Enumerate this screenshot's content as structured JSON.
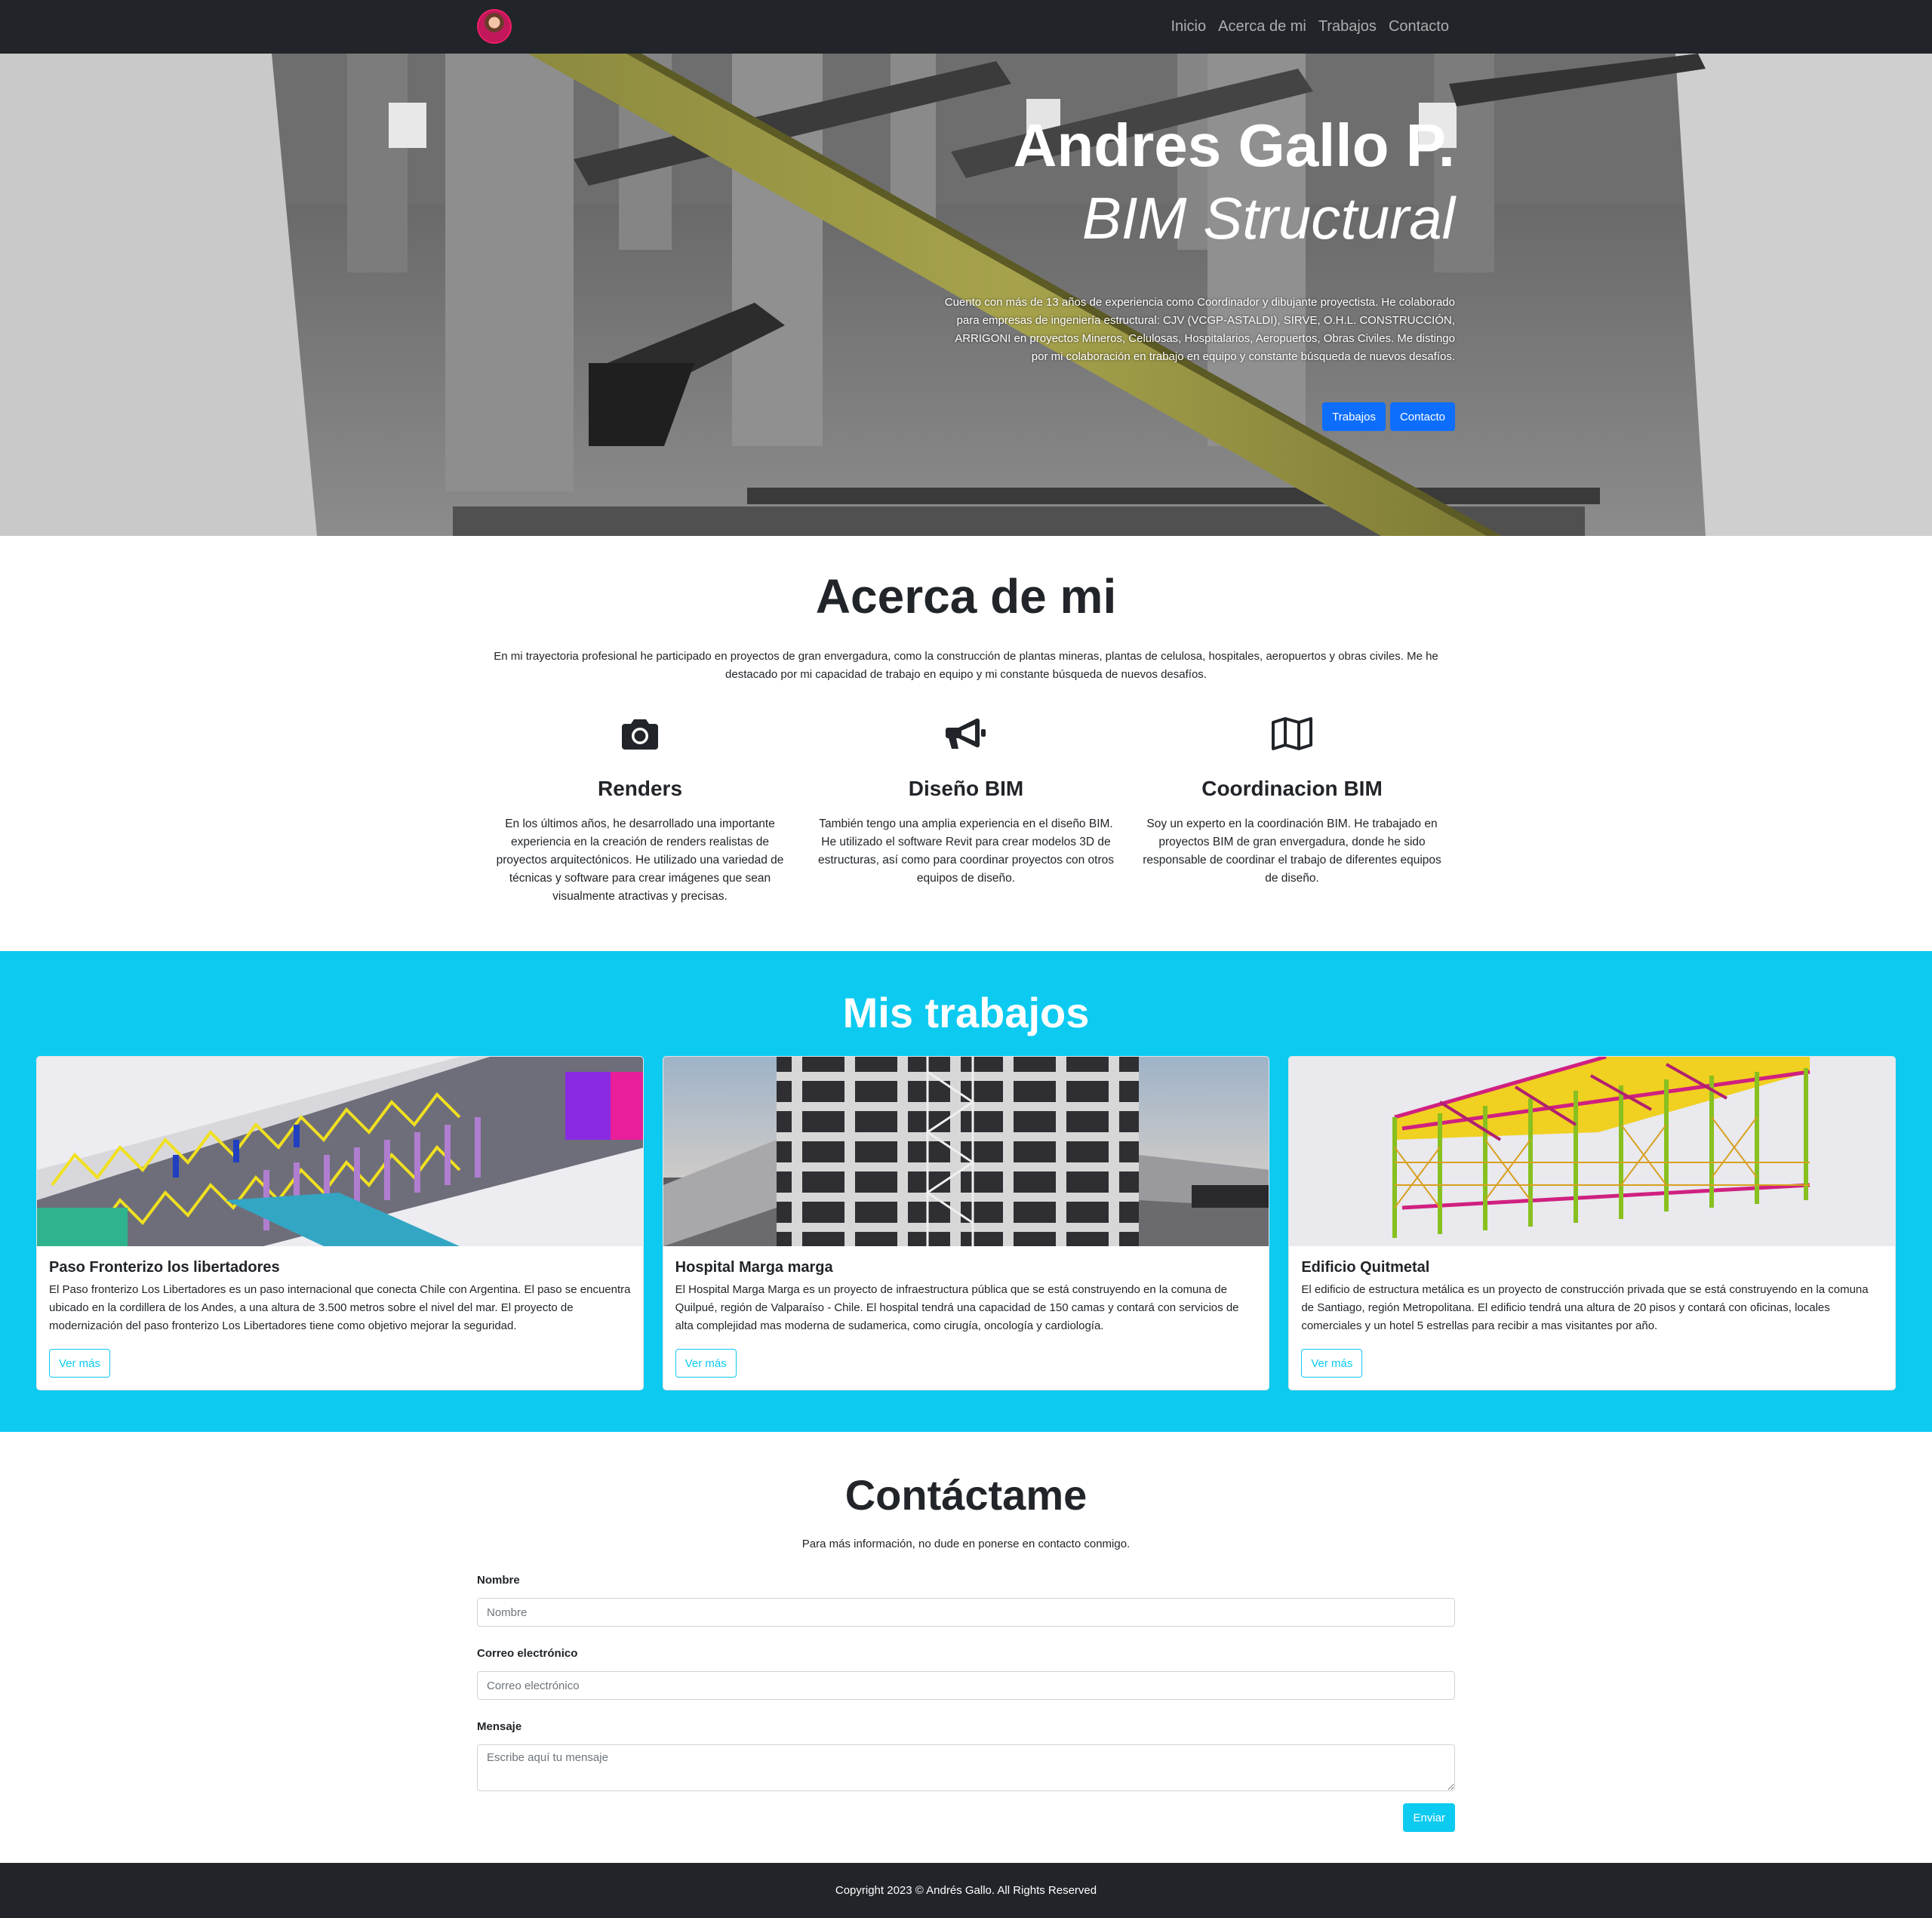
{
  "nav": {
    "links": [
      "Inicio",
      "Acerca de mi",
      "Trabajos",
      "Contacto"
    ]
  },
  "hero": {
    "name": "Andres Gallo P.",
    "role": "BIM Structural",
    "description": "Cuento con más de 13 años de experiencia como Coordinador y dibujante proyectista. He colaborado para empresas de ingeniería estructural: CJV (VCGP-ASTALDI), SIRVE, O.H.L. CONSTRUCCIÓN, ARRIGONI en proyectos Mineros, Celulosas, Hospitalarios, Aeropuertos, Obras Civiles. Me distingo por mi colaboración en trabajo en equipo y constante búsqueda de nuevos desafíos.",
    "btn_works": "Trabajos",
    "btn_contact": "Contacto"
  },
  "about": {
    "title": "Acerca de mi",
    "intro": "En mi trayectoria profesional he participado en proyectos de gran envergadura, como la construcción de plantas mineras, plantas de celulosa, hospitales, aeropuertos y obras civiles. Me he destacado por mi capacidad de trabajo en equipo y mi constante búsqueda de nuevos desafíos.",
    "features": [
      {
        "icon": "camera-icon",
        "title": "Renders",
        "text": "En los últimos años, he desarrollado una importante experiencia en la creación de renders realistas de proyectos arquitectónicos. He utilizado una variedad de técnicas y software para crear imágenes que sean visualmente atractivas y precisas."
      },
      {
        "icon": "megaphone-icon",
        "title": "Diseño BIM",
        "text": "También tengo una amplia experiencia en el diseño BIM. He utilizado el software Revit para crear modelos 3D de estructuras, así como para coordinar proyectos con otros equipos de diseño."
      },
      {
        "icon": "map-icon",
        "title": "Coordinacion BIM",
        "text": "Soy un experto en la coordinación BIM. He trabajado en proyectos BIM de gran envergadura, donde he sido responsable de coordinar el trabajo de diferentes equipos de diseño."
      }
    ]
  },
  "works": {
    "title": "Mis trabajos",
    "cards": [
      {
        "title": "Paso Fronterizo los libertadores",
        "text": "El Paso fronterizo Los Libertadores es un paso internacional que conecta Chile con Argentina. El paso se encuentra ubicado en la cordillera de los Andes, a una altura de 3.500 metros sobre el nivel del mar. El proyecto de modernización del paso fronterizo Los Libertadores tiene como objetivo mejorar la seguridad.",
        "button": "Ver más"
      },
      {
        "title": "Hospital Marga marga",
        "text": "El Hospital Marga Marga es un proyecto de infraestructura pública que se está construyendo en la comuna de Quilpué, región de Valparaíso - Chile. El hospital tendrá una capacidad de 150 camas y contará con servicios de alta complejidad mas moderna de sudamerica, como cirugía, oncología y cardiología.",
        "button": "Ver más"
      },
      {
        "title": "Edificio Quitmetal",
        "text": "El edificio de estructura metálica es un proyecto de construcción privada que se está construyendo en la comuna de Santiago, región Metropolitana. El edificio tendrá una altura de 20 pisos y contará con oficinas, locales comerciales y un hotel 5 estrellas para recibir a mas visitantes por año.",
        "button": "Ver más"
      }
    ]
  },
  "contact": {
    "title": "Contáctame",
    "subtitle": "Para más información, no dude en ponerse en contacto conmigo.",
    "name_label": "Nombre",
    "name_placeholder": "Nombre",
    "email_label": "Correo electrónico",
    "email_placeholder": "Correo electrónico",
    "message_label": "Mensaje",
    "message_placeholder": "Escribe aquí tu mensaje",
    "submit": "Enviar"
  },
  "footer": {
    "text": "Copyright 2023 © Andrés Gallo. All Rights Reserved"
  },
  "colors": {
    "navbar": "#212529",
    "primary": "#0d6efd",
    "info": "#0dcaf0",
    "text": "#212529"
  }
}
